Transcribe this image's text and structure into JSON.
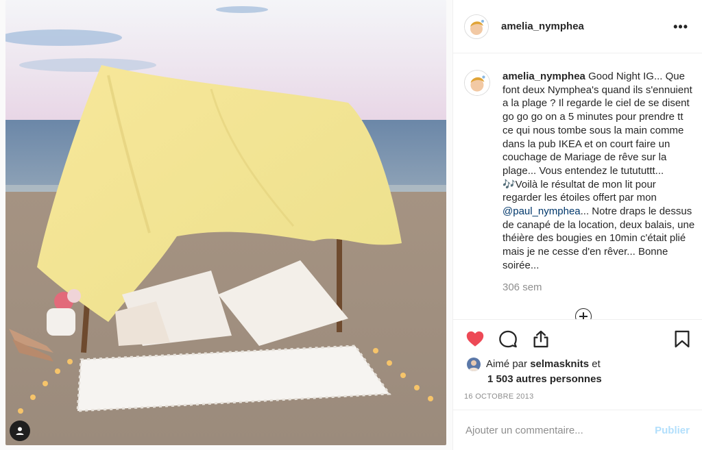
{
  "post": {
    "username": "amelia_nymphea",
    "more_label": "•••",
    "caption_text": " Good Night IG... Que font deux Nymphea's quand ils s'ennuient a la plage ? Il regarde le ciel de se disent go go go on a 5 minutes pour prendre tt ce qui nous tombe sous la main comme dans la pub IKEA et on court faire un couchage de Mariage de rêve sur la plage... Vous entendez le tutututtt... 🎶Voilà le résultat de mon lit pour regarder les étoiles offert par mon ",
    "mention": "@paul_nymphea",
    "caption_text_after": "... Notre draps le dessus de canapé de la location, deux balais, une théière des bougies en 10min c'était plié mais je ne cesse d'en rêver... Bonne soirée...",
    "caption_time": "306 sem",
    "liked_by_prefix": "Aimé par ",
    "liked_by_user": "selmasknits",
    "liked_by_suffix": " et",
    "others_count": "1 503 autres personnes",
    "date": "16 octobre 2013"
  },
  "comment_box": {
    "placeholder": "Ajouter un commentaire...",
    "publish_label": "Publier"
  },
  "colors": {
    "like": "#ed4956",
    "mention": "#00376b",
    "publish_disabled": "#b2dffc"
  },
  "icons": [
    "heart-icon",
    "comment-icon",
    "share-icon",
    "bookmark-icon",
    "add-comments-icon",
    "user-tag-icon",
    "more-icon"
  ]
}
